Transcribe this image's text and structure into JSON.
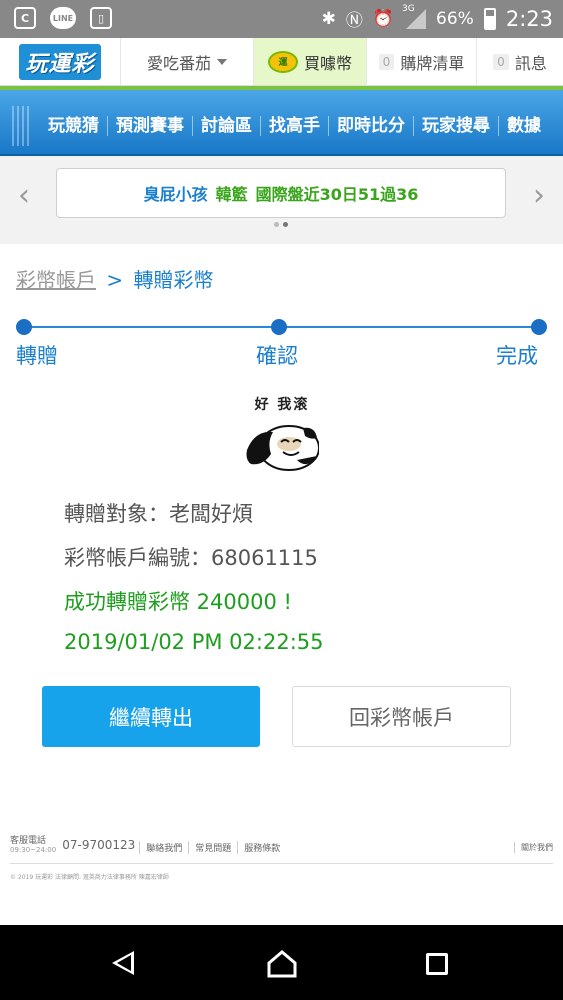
{
  "status_bar": {
    "battery": "66%",
    "time": "2:23",
    "network": "3G"
  },
  "top_nav": {
    "logo": "玩運彩",
    "username": "愛吃番茄",
    "buy_coins": "買噱幣",
    "buy_list_count": "0",
    "buy_list": "購牌清單",
    "messages_count": "0",
    "messages": "訊息"
  },
  "menu": {
    "items": [
      "玩競猜",
      "預測賽事",
      "討論區",
      "找高手",
      "即時比分",
      "玩家搜尋",
      "數據"
    ]
  },
  "ticker": {
    "user": "臭屁小孩",
    "league": "韓籃",
    "record": "國際盤近30日51過36"
  },
  "breadcrumb": {
    "parent": "彩幣帳戶",
    "separator": ">",
    "current": "轉贈彩幣"
  },
  "steps": [
    "轉贈",
    "確認",
    "完成"
  ],
  "meme": {
    "caption": "好 我滚"
  },
  "result": {
    "recipient": "轉贈對象：老闆好煩",
    "account": "彩幣帳戶編號：68061115",
    "success": "成功轉贈彩幣 240000 !",
    "timestamp": "2019/01/02 PM 02:22:55"
  },
  "buttons": {
    "continue": "繼續轉出",
    "back": "回彩幣帳戶"
  },
  "footer": {
    "service_label": "客服電話",
    "hours": "09:30~24:00",
    "phone": "07-9700123",
    "links": [
      "聯絡我們",
      "常見問題",
      "服務條款"
    ],
    "close": "關於我們",
    "copyright": "© 2019 玩運彩 法律顧問: 滙英商力法律事務所 陳嘉宏律師"
  },
  "colors": {
    "brand_blue": "#1a7fce",
    "success_green": "#1e9e1e",
    "button_blue": "#17a3eb"
  }
}
